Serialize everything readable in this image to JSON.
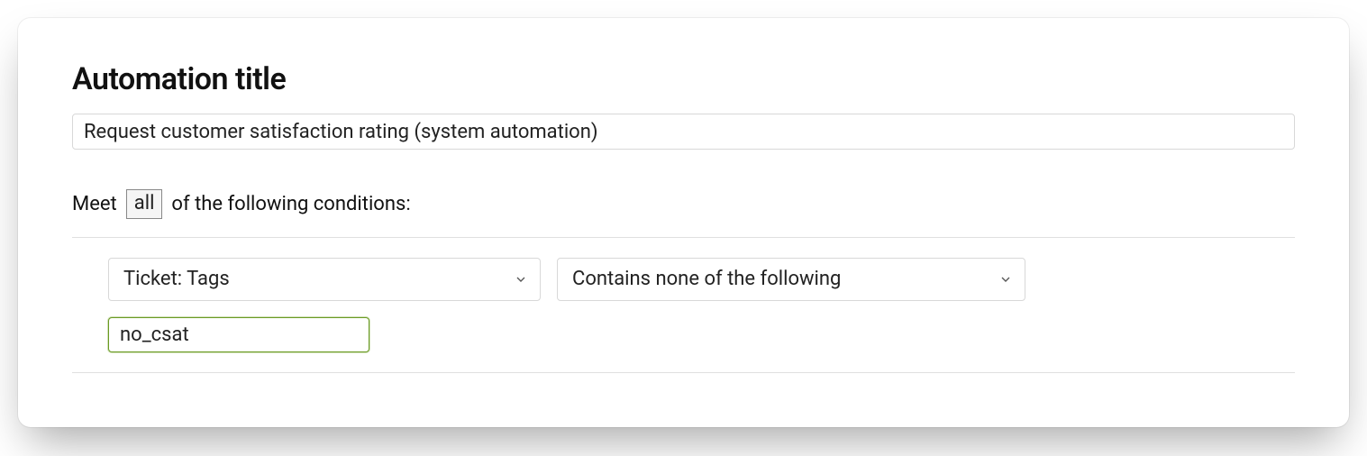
{
  "heading": "Automation title",
  "title_value": "Request customer satisfaction rating (system automation)",
  "conditions": {
    "prefix": "Meet",
    "badge": "all",
    "suffix": "of the following conditions:"
  },
  "condition_row": {
    "field": "Ticket: Tags",
    "operator": "Contains none of the following",
    "tag": "no_csat"
  }
}
